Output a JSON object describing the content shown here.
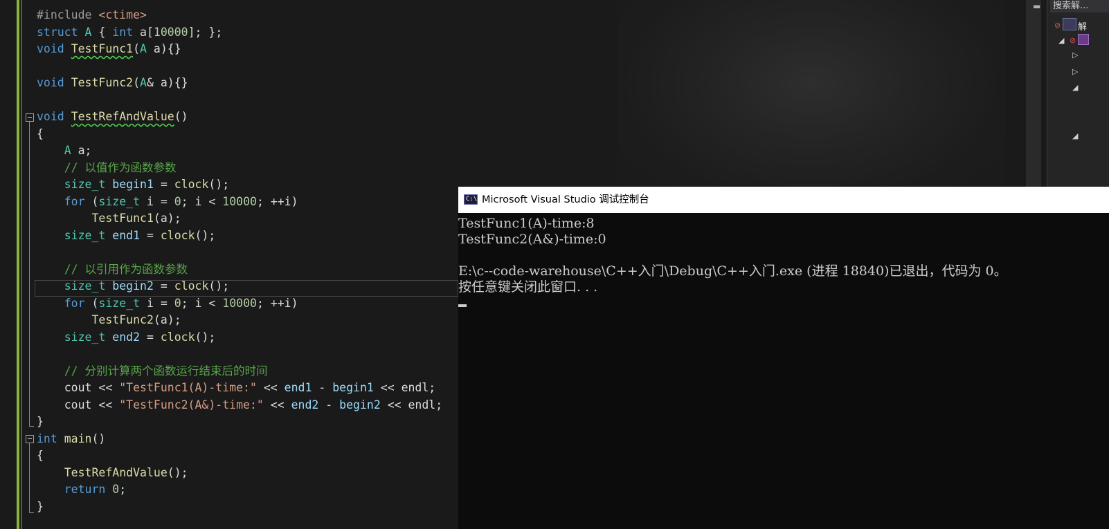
{
  "editor": {
    "lines": [
      "#include <ctime>",
      "struct A { int a[10000]; };",
      "void TestFunc1(A a){}",
      "",
      "void TestFunc2(A& a){}",
      "",
      "void TestRefAndValue()",
      "{",
      "    A a;",
      "    // 以值作为函数参数",
      "    size_t begin1 = clock();",
      "    for (size_t i = 0; i < 10000; ++i)",
      "        TestFunc1(a);",
      "    size_t end1 = clock();",
      "",
      "    // 以引用作为函数参数",
      "    size_t begin2 = clock();",
      "    for (size_t i = 0; i < 10000; ++i)",
      "        TestFunc2(a);",
      "    size_t end2 = clock();",
      "",
      "    // 分别计算两个函数运行结束后的时间",
      "    cout << \"TestFunc1(A)-time:\" << end1 - begin1 << endl;",
      "    cout << \"TestFunc2(A&)-time:\" << end2 - begin2 << endl;",
      "}",
      "int main()",
      "{",
      "    TestRefAndValue();",
      "    return 0;",
      "}"
    ]
  },
  "right_panel": {
    "search_placeholder": "搜索解..."
  },
  "console": {
    "title": "Microsoft Visual Studio 调试控制台",
    "icon_label": "C:\\",
    "output": [
      "TestFunc1(A)-time:8",
      "TestFunc2(A&)-time:0",
      "",
      "E:\\c--code-warehouse\\C++入门\\Debug\\C++入门.exe (进程 18840)已退出，代码为 0。",
      "按任意键关闭此窗口. . ."
    ]
  },
  "colors": {
    "keyword": "#569cd6",
    "type": "#4ec9b0",
    "string": "#d69d85",
    "number": "#b5cea8",
    "comment": "#57a64a",
    "function": "#dcdcaa",
    "variable": "#9cdcfe",
    "margin": "#8ab33b"
  }
}
